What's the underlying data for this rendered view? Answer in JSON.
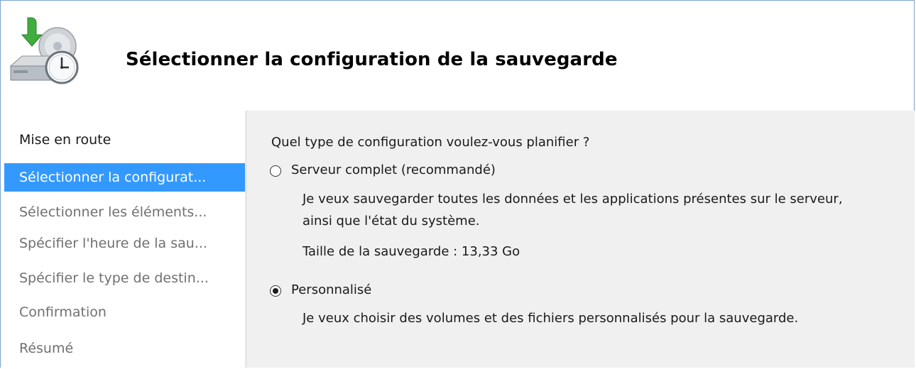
{
  "header": {
    "title": "Sélectionner la configuration de la sauvegarde",
    "icon": "backup-clock-icon"
  },
  "sidebar": {
    "steps": [
      {
        "label": "Mise en route",
        "state": "done"
      },
      {
        "label": "Sélectionner la configurat...",
        "state": "active"
      },
      {
        "label": "Sélectionner les éléments...",
        "state": "pending"
      },
      {
        "label": "Spécifier l'heure de la sau...",
        "state": "pending"
      },
      {
        "label": "Spécifier le type de destin...",
        "state": "pending"
      },
      {
        "label": "Confirmation",
        "state": "pending"
      },
      {
        "label": "Résumé",
        "state": "pending"
      }
    ]
  },
  "main": {
    "question": "Quel type de configuration voulez-vous planifier ?",
    "options": [
      {
        "label": "Serveur complet (recommandé)",
        "selected": false,
        "description_line1": "Je veux sauvegarder toutes les données et les applications présentes sur le serveur,",
        "description_line2": "ainsi que l'état du système.",
        "size_text": "Taille de la sauvegarde : 13,33 Go"
      },
      {
        "label": "Personnalisé",
        "selected": true,
        "description_line1": "Je veux choisir des volumes et des fichiers personnalisés pour la sauvegarde."
      }
    ]
  },
  "colors": {
    "active_step_bg": "#3399ff",
    "content_bg": "#f0f0f0",
    "border": "#7da2ce"
  }
}
